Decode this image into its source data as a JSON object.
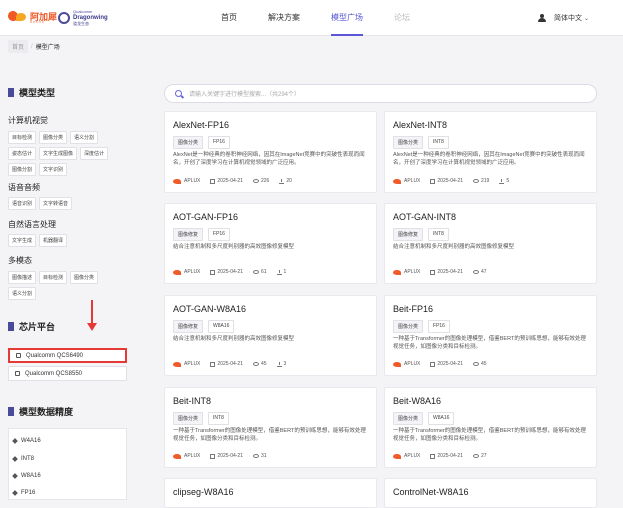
{
  "header": {
    "logo_text": "阿加犀",
    "logo_sub": "APLUX",
    "partner_line1": "Qualcomm",
    "partner_line2": "Dragonwing",
    "partner_line3": "骁龙生态",
    "nav": [
      "首页",
      "解决方案",
      "模型广场",
      "论坛"
    ],
    "lang": "简体中文"
  },
  "breadcrumb": {
    "home": "首页",
    "current": "模型广场"
  },
  "sidebar": {
    "model_type_title": "模型类型",
    "cv_title": "计算机视觉",
    "cv_tags": [
      "目标检测",
      "图像分类",
      "语义分割",
      "姿态估计",
      "文字生成图像",
      "深度估计",
      "图像分割",
      "文字识别"
    ],
    "audio_title": "语音音频",
    "audio_tags": [
      "语音识别",
      "文字转语音"
    ],
    "nlp_title": "自然语言处理",
    "nlp_tags": [
      "文字生成",
      "机器翻译"
    ],
    "multi_title": "多模态",
    "multi_tags": [
      "图像描述",
      "目标检测",
      "图像分类",
      "语义分割"
    ],
    "chip_title": "芯片平台",
    "chips": [
      "Qualcomm QCS6490",
      "Qualcomm QCS8550"
    ],
    "precision_title": "模型数据精度",
    "precisions": [
      "W4A16",
      "INT8",
      "W8A16",
      "FP16"
    ]
  },
  "search": {
    "placeholder": "请输入关键字进行模型搜索...（共294个）"
  },
  "cards": [
    {
      "title": "AlexNet-FP16",
      "category": "图像分类",
      "precision": "FP16",
      "desc": "AlexNet是一种经典的卷积神经网络，因其在ImageNet竞赛中的突破性表现而闻名，开创了深度学习在计算机视觉领域的广泛应用。",
      "vendor": "APLUX",
      "date": "2025-04-21",
      "views": "226",
      "downloads": "20"
    },
    {
      "title": "AlexNet-INT8",
      "category": "图像分类",
      "precision": "INT8",
      "desc": "AlexNet是一种经典的卷积神经网络，因其在ImageNet竞赛中的突破性表现而闻名，开创了深度学习在计算机视觉领域的广泛应用。",
      "vendor": "APLUX",
      "date": "2025-04-21",
      "views": "219",
      "downloads": "5"
    },
    {
      "title": "AOT-GAN-FP16",
      "category": "图像修复",
      "precision": "FP16",
      "desc": "结合注意机制和多尺度判别器的高效图像修复模型",
      "vendor": "APLUX",
      "date": "2025-04-21",
      "views": "61",
      "downloads": "1"
    },
    {
      "title": "AOT-GAN-INT8",
      "category": "图像修复",
      "precision": "INT8",
      "desc": "结合注意机制和多尺度判别器的高效图像修复模型",
      "vendor": "APLUX",
      "date": "2025-04-21",
      "views": "47",
      "downloads": ""
    },
    {
      "title": "AOT-GAN-W8A16",
      "category": "图像修复",
      "precision": "W8A16",
      "desc": "结合注意机制和多尺度判别器的高效图像修复模型",
      "vendor": "APLUX",
      "date": "2025-04-21",
      "views": "45",
      "downloads": "3"
    },
    {
      "title": "Beit-FP16",
      "category": "图像分类",
      "precision": "FP16",
      "desc": "一种基于Transformer的图像处理模型，借鉴BERT的预训练思想，能够有效处理视觉任务，如图像分类和目标检测。",
      "vendor": "APLUX",
      "date": "2025-04-21",
      "views": "45",
      "downloads": ""
    },
    {
      "title": "Beit-INT8",
      "category": "图像分类",
      "precision": "INT8",
      "desc": "一种基于Transformer的图像处理模型，借鉴BERT的预训练思想，能够有效处理视觉任务，如图像分类和目标检测。",
      "vendor": "APLUX",
      "date": "2025-04-21",
      "views": "31",
      "downloads": ""
    },
    {
      "title": "Beit-W8A16",
      "category": "图像分类",
      "precision": "W8A16",
      "desc": "一种基于Transformer的图像处理模型，借鉴BERT的预训练思想，能够有效处理视觉任务，如图像分类和目标检测。",
      "vendor": "APLUX",
      "date": "2025-04-21",
      "views": "27",
      "downloads": ""
    },
    {
      "title": "clipseg-W8A16",
      "category": "",
      "precision": "",
      "desc": "",
      "vendor": "",
      "date": "",
      "views": "",
      "downloads": ""
    },
    {
      "title": "ControlNet-W8A16",
      "category": "",
      "precision": "",
      "desc": "",
      "vendor": "",
      "date": "",
      "views": "",
      "downloads": ""
    }
  ]
}
